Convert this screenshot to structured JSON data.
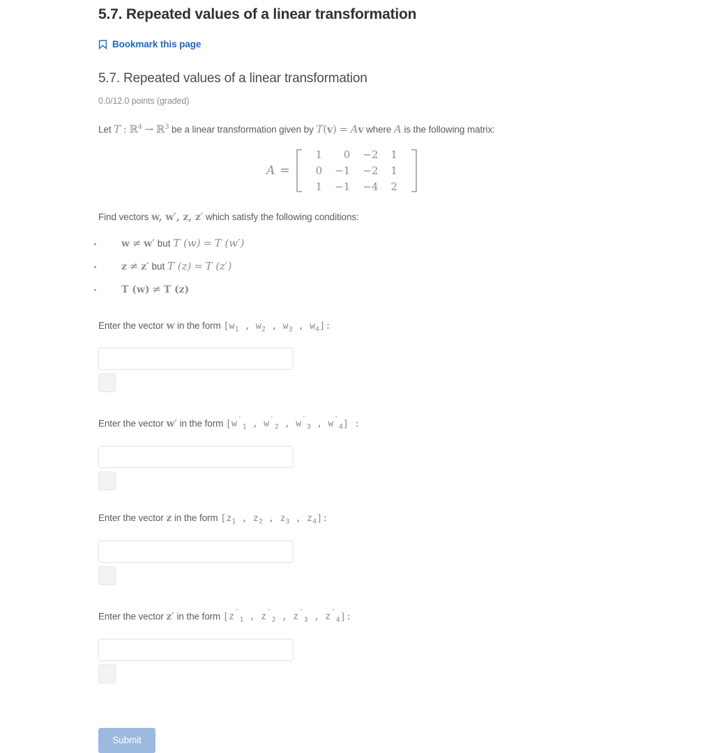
{
  "page": {
    "title": "5.7. Repeated values of a linear transformation",
    "bookmark_label": "Bookmark this page",
    "bookmark_icon": "bookmark-icon",
    "accent_color": "#1d68c3",
    "background_color": "#ffffff"
  },
  "problem": {
    "title": "5.7. Repeated values of a linear transformation",
    "points_text": "0.0/12.0 points (graded)",
    "statement": {
      "prefix": "Let",
      "transform_symbol": "T",
      "colon": ":",
      "domain": "R",
      "domain_exponent": "4",
      "arrow": "→",
      "codomain": "R",
      "codomain_exponent": "3",
      "middle": "be a linear transformation given by",
      "equation_lhs": "T",
      "equation_arg_open": "(",
      "equation_arg": "v",
      "equation_arg_close": ")",
      "equation_equals": "=",
      "equation_matrix": "A",
      "equation_vector": "v",
      "where_word": "where",
      "matrix_symbol": "A",
      "suffix": "is the following matrix:"
    },
    "matrix": {
      "lhs": "A",
      "equals": "=",
      "rows": [
        [
          "1",
          "0",
          "−2",
          "1"
        ],
        [
          "0",
          "−1",
          "−2",
          "1"
        ],
        [
          "1",
          "−1",
          "−4",
          "2"
        ]
      ]
    },
    "find_line": {
      "prefix": "Find vectors",
      "vectors": "w, w′, z, z′",
      "suffix": "which satisfy the following conditions:"
    },
    "conditions": [
      {
        "left_a": "w",
        "neq": "≠",
        "left_b": "w′",
        "connector": "but",
        "right_lhs": "T (w)",
        "eq": "=",
        "right_rhs": "T (w′)"
      },
      {
        "left_a": "z",
        "neq": "≠",
        "left_b": "z′",
        "connector": "but",
        "right_lhs": "T (z)",
        "eq": "=",
        "right_rhs": "T (z′)"
      },
      {
        "left_a": "T (w)",
        "neq": "≠",
        "left_b": "T (z)",
        "connector": "",
        "right_lhs": "",
        "eq": "",
        "right_rhs": ""
      }
    ]
  },
  "fields": [
    {
      "label_prefix": "Enter the vector",
      "vector_symbol": "w",
      "label_middle": "in the form",
      "form_open": "[",
      "form_components": [
        "w1",
        "w2",
        "w3",
        "w4"
      ],
      "form_close": "]:",
      "value": "",
      "placeholder": "",
      "preview_toggle_name": "answer-preview-toggle"
    },
    {
      "label_prefix": "Enter the vector",
      "vector_symbol": "w′",
      "label_middle": "in the form",
      "form_open": "[",
      "form_components": [
        "w′1",
        "w′2",
        "w′3",
        "w′4"
      ],
      "form_close": "] :",
      "value": "",
      "placeholder": "",
      "preview_toggle_name": "answer-preview-toggle"
    },
    {
      "label_prefix": "Enter the vector",
      "vector_symbol": "z",
      "label_middle": "in the form",
      "form_open": "[",
      "form_components": [
        "z1",
        "z2",
        "z3",
        "z4"
      ],
      "form_close": "]:",
      "value": "",
      "placeholder": "",
      "preview_toggle_name": "answer-preview-toggle"
    },
    {
      "label_prefix": "Enter the vector",
      "vector_symbol": "z′",
      "label_middle": "in the form",
      "form_open": "[",
      "form_components": [
        "z′1",
        "z′2",
        "z′3",
        "z′4"
      ],
      "form_close": "]:",
      "value": "",
      "placeholder": "",
      "preview_toggle_name": "answer-preview-toggle"
    }
  ],
  "submit": {
    "label": "Submit",
    "color": "#9cb9e0",
    "text_color": "#ffffff"
  }
}
